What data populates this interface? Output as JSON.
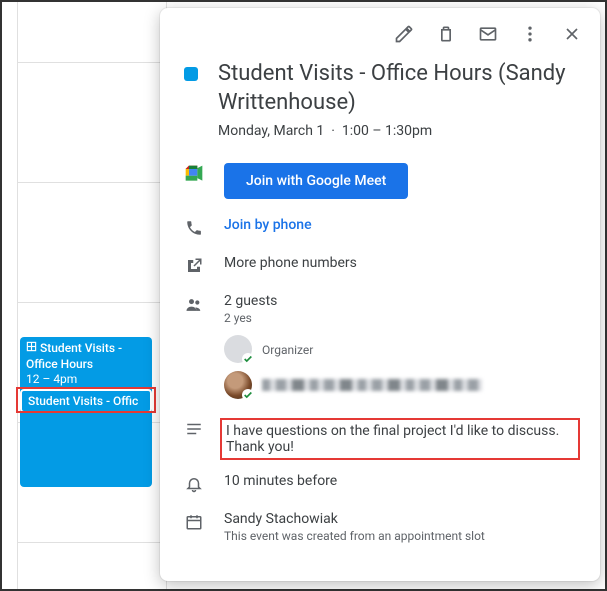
{
  "calendar": {
    "main_event": {
      "title": "Student Visits - Office Hours",
      "time": "12 – 4pm"
    },
    "chip_event": {
      "title": "Student Visits - Offic"
    }
  },
  "popover": {
    "title": "Student Visits - Office Hours (Sandy Writtenhouse)",
    "date": "Monday, March 1",
    "time": "1:00 – 1:30pm",
    "meet_button": "Join with Google Meet",
    "phone_link": "Join by phone",
    "more_numbers": "More phone numbers",
    "guests": {
      "count": "2 guests",
      "yes": "2 yes",
      "organizer_label": "Organizer"
    },
    "description": "I have questions on the final project I'd like to discuss. Thank you!",
    "reminder": "10 minutes before",
    "creator": {
      "name": "Sandy Stachowiak",
      "slot_note": "This event was created from an appointment slot"
    }
  }
}
